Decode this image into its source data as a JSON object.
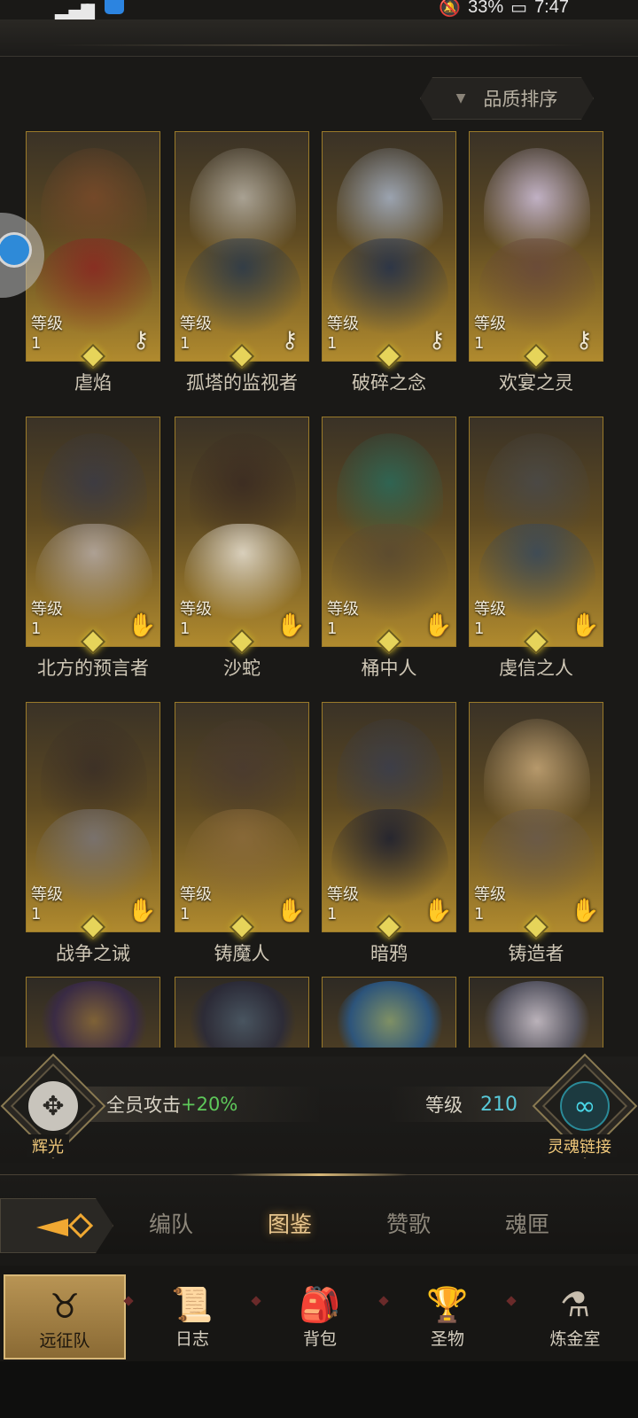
{
  "status_bar": {
    "battery": "33%",
    "time": "7:47"
  },
  "sort": {
    "label": "品质排序"
  },
  "heroes": [
    {
      "name": "虐焰",
      "level_label": "等级",
      "level": "1",
      "class_icon": "key-icon",
      "colors": [
        "#7a4a2a",
        "#8a2a22"
      ]
    },
    {
      "name": "孤塔的监视者",
      "level_label": "等级",
      "level": "1",
      "class_icon": "key-icon",
      "colors": [
        "#b8b2a6",
        "#2c3a4a"
      ]
    },
    {
      "name": "破碎之念",
      "level_label": "等级",
      "level": "1",
      "class_icon": "key-icon",
      "colors": [
        "#a8b4c8",
        "#26324a"
      ]
    },
    {
      "name": "欢宴之灵",
      "level_label": "等级",
      "level": "1",
      "class_icon": "key-icon",
      "colors": [
        "#d4c4e0",
        "#6a4a3a"
      ]
    },
    {
      "name": "北方的预言者",
      "level_label": "等级",
      "level": "1",
      "class_icon": "hand-icon",
      "colors": [
        "#3a3a46",
        "#b4a8a0"
      ]
    },
    {
      "name": "沙蛇",
      "level_label": "等级",
      "level": "1",
      "class_icon": "hand-icon",
      "colors": [
        "#3a2a22",
        "#e4dccc"
      ]
    },
    {
      "name": "桶中人",
      "level_label": "等级",
      "level": "1",
      "class_icon": "hand-icon",
      "colors": [
        "#2a6a5a",
        "#5a4a30"
      ]
    },
    {
      "name": "虔信之人",
      "level_label": "等级",
      "level": "1",
      "class_icon": "hand-icon",
      "colors": [
        "#4a4a4a",
        "#3a4a5a"
      ]
    },
    {
      "name": "战争之诫",
      "level_label": "等级",
      "level": "1",
      "class_icon": "hand-icon",
      "colors": [
        "#3a2e26",
        "#7a7474"
      ]
    },
    {
      "name": "铸魔人",
      "level_label": "等级",
      "level": "1",
      "class_icon": "hand-icon",
      "colors": [
        "#4a3a30",
        "#8a6a3a"
      ]
    },
    {
      "name": "暗鸦",
      "level_label": "等级",
      "level": "1",
      "class_icon": "hand-icon",
      "colors": [
        "#3a3e4e",
        "#1e2030"
      ]
    },
    {
      "name": "铸造者",
      "level_label": "等级",
      "level": "1",
      "class_icon": "hand-icon",
      "colors": [
        "#c8a878",
        "#6a5a4a"
      ]
    }
  ],
  "partial_heroes": [
    {
      "colors": [
        "#8a6a3a",
        "#3a2a4a"
      ]
    },
    {
      "colors": [
        "#4a5a6a",
        "#2a2a3a"
      ]
    },
    {
      "colors": [
        "#8aa070",
        "#2a5a8a"
      ]
    },
    {
      "colors": [
        "#d0c8d4",
        "#5a5a6a"
      ]
    }
  ],
  "stats": {
    "radiance_label": "辉光",
    "bonus_label": "全员攻击",
    "bonus_value": "+20%",
    "level_label": "等级",
    "level_value": "210",
    "soul_link_label": "灵魂链接"
  },
  "tabs": [
    {
      "label": "编队"
    },
    {
      "label": "图鉴"
    },
    {
      "label": "赞歌"
    },
    {
      "label": "魂匣"
    }
  ],
  "active_tab": 1,
  "nav": [
    {
      "label": "远征队",
      "icon": "horned-helmet-icon"
    },
    {
      "label": "日志",
      "icon": "scroll-icon"
    },
    {
      "label": "背包",
      "icon": "backpack-icon"
    },
    {
      "label": "圣物",
      "icon": "chalice-icon"
    },
    {
      "label": "炼金室",
      "icon": "alchemy-icon"
    }
  ],
  "active_nav": 0
}
